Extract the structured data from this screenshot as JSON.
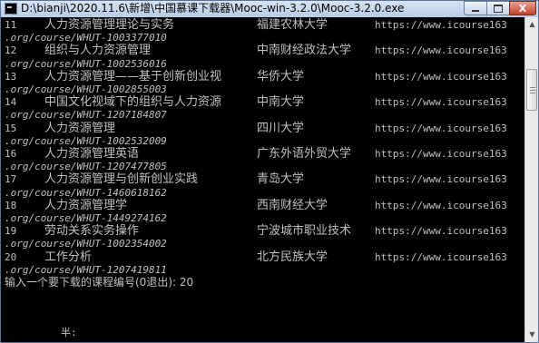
{
  "window": {
    "title": "D:\\bianji\\2020.11.6\\新增\\中国慕课下载器\\Mooc-win-3.2.0\\Mooc-3.2.0.exe",
    "minimize_label": "",
    "maximize_label": "",
    "close_label": "X"
  },
  "console": {
    "rows": [
      {
        "no": "11",
        "course": "人力资源管理理论与实务",
        "school": "福建农林大学",
        "url_head": "https://www.icourse163",
        "url_tail": ".org/course/WHUT-1003377010"
      },
      {
        "no": "12",
        "course": "组织与人力资源管理",
        "school": "中南财经政法大学",
        "url_head": "https://www.icourse163",
        "url_tail": ".org/course/WHUT-1002536016"
      },
      {
        "no": "13",
        "course": "人力资源管理——基于创新创业视",
        "school": "华侨大学",
        "url_head": "https://www.icourse163",
        "url_tail": ".org/course/WHUT-1002855003"
      },
      {
        "no": "14",
        "course": "中国文化视域下的组织与人力资源",
        "school": "中南大学",
        "url_head": "https://www.icourse163",
        "url_tail": ".org/course/WHUT-1207184807"
      },
      {
        "no": "15",
        "course": "人力资源管理",
        "school": "四川大学",
        "url_head": "https://www.icourse163",
        "url_tail": ".org/course/WHUT-1002532009"
      },
      {
        "no": "16",
        "course": "人力资源管理英语",
        "school": "广东外语外贸大学",
        "url_head": "https://www.icourse163",
        "url_tail": ".org/course/WHUT-1207477805"
      },
      {
        "no": "17",
        "course": "人力资源管理与创新创业实践",
        "school": "青岛大学",
        "url_head": "https://www.icourse163",
        "url_tail": ".org/course/WHUT-1460618162"
      },
      {
        "no": "18",
        "course": "人力资源管理学",
        "school": "西南财经大学",
        "url_head": "https://www.icourse163",
        "url_tail": ".org/course/WHUT-1449274162"
      },
      {
        "no": "19",
        "course": "劳动关系实务操作",
        "school": "宁波城市职业技术",
        "url_head": "https://www.icourse163",
        "url_tail": ".org/course/WHUT-1002354002"
      },
      {
        "no": "20",
        "course": "工作分析",
        "school": "北方民族大学",
        "url_head": "https://www.icourse163",
        "url_tail": ".org/course/WHUT-1207419811"
      }
    ],
    "prompt": "输入一个要下载的课程编号(0退出): 20",
    "status_text": "半:"
  },
  "scrollbar": {
    "up_arrow": "▲",
    "down_arrow": "▼"
  }
}
